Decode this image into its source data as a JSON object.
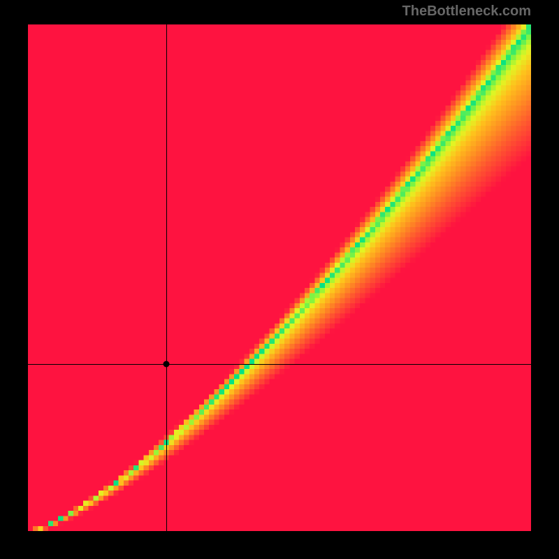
{
  "watermark": "TheBottleneck.com",
  "chart_data": {
    "type": "heatmap",
    "title": "",
    "xlabel": "",
    "ylabel": "",
    "xlim": [
      0,
      1
    ],
    "ylim": [
      0,
      1
    ],
    "grid": false,
    "crosshair": {
      "x": 0.275,
      "y": 0.33
    },
    "marker": {
      "x": 0.275,
      "y": 0.33
    },
    "optimal_curve": {
      "description": "y ≈ x^1.35 (green optimal band)"
    },
    "colorscale": {
      "description": "Red→Orange→Yellow→Green based on distance from optimal curve; upper-right corner tends orange/yellow, left & bottom edges red",
      "stops": [
        {
          "t": 0.0,
          "color": "#00E286"
        },
        {
          "t": 0.08,
          "color": "#8EF53B"
        },
        {
          "t": 0.16,
          "color": "#E2F523"
        },
        {
          "t": 0.3,
          "color": "#FEC21C"
        },
        {
          "t": 0.5,
          "color": "#FE8F22"
        },
        {
          "t": 0.7,
          "color": "#FE5A2E"
        },
        {
          "t": 1.0,
          "color": "#FE1340"
        }
      ]
    },
    "grid_resolution": 100
  }
}
